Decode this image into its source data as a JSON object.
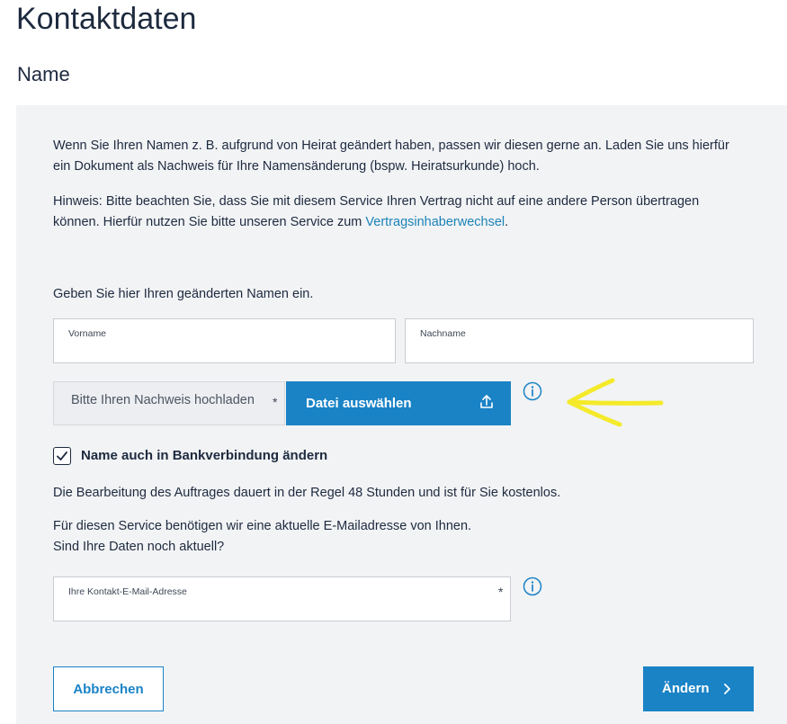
{
  "page": {
    "title": "Kontaktdaten"
  },
  "section": {
    "title": "Name"
  },
  "intro": {
    "paragraph1": "Wenn Sie Ihren Namen z. B. aufgrund von Heirat geändert haben, passen wir diesen gerne an. Laden Sie uns hierfür ein Dokument als Nachweis für Ihre Namensänderung (bspw. Heiratsurkunde) hoch.",
    "hint_text": "Hinweis: Bitte beachten Sie, dass Sie mit diesem Service Ihren Vertrag nicht auf eine andere Person übertragen können. Hierfür nutzen Sie bitte unseren Service zum ",
    "hint_link": "Vertragsinhaberwechsel",
    "hint_end": "."
  },
  "form": {
    "name_prompt": "Geben Sie hier Ihren geänderten Namen ein.",
    "firstname": {
      "label": "Vorname",
      "value": ""
    },
    "lastname": {
      "label": "Nachname",
      "value": ""
    },
    "upload": {
      "label": "Bitte Ihren Nachweis hochladen",
      "required_mark": "*",
      "button_label": "Datei auswählen"
    },
    "bank_checkbox": {
      "label": "Name auch in Bankverbindung ändern",
      "checked": true
    },
    "processing_note": "Die Bearbeitung des Auftrages dauert in der Regel 48 Stunden und ist für Sie kostenlos.",
    "email_prompt_line1": "Für diesen Service benötigen wir eine aktuelle E-Mailadresse von Ihnen.",
    "email_prompt_line2": "Sind Ihre Daten noch aktuell?",
    "email": {
      "label": "Ihre Kontakt-E-Mail-Adresse",
      "required_mark": "*",
      "value": ""
    }
  },
  "actions": {
    "cancel_label": "Abbrechen",
    "submit_label": "Ändern"
  },
  "colors": {
    "accent": "#1a83c6",
    "panel_bg": "#f2f3f5",
    "text": "#1d2a3f",
    "annotation": "#f4ea2a"
  },
  "icons": {
    "info": "info-icon",
    "upload": "upload-icon",
    "check": "checkmark-icon",
    "chevron": "chevron-right-icon",
    "arrow": "arrow-left-icon"
  }
}
